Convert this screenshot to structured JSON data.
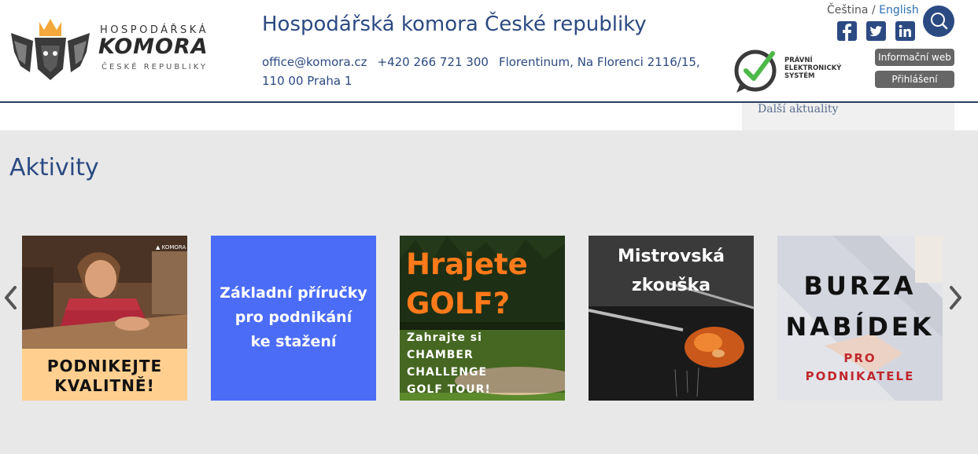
{
  "header": {
    "logo": {
      "line1": "HOSPODÁŘSKÁ",
      "line2": "KOMORA",
      "line3": "ČESKÉ REPUBLIKY"
    },
    "title": "Hospodářská komora České republiky",
    "contact": {
      "email": "office@komora.cz",
      "phone": "+420 266 721 300",
      "address": "Florentinum, Na Florenci 2116/15, 110 00 Praha 1"
    },
    "legal_system": {
      "line1": "PRÁVNÍ",
      "line2": "ELEKTRONICKÝ",
      "line3": "SYSTÉM"
    },
    "languages": {
      "cs": "Čeština",
      "separator": "/",
      "en": "English"
    },
    "social": [
      "facebook-icon",
      "twitter-icon",
      "linkedin-icon"
    ],
    "buttons": {
      "info_web": "Informační web",
      "login": "Přihlášení"
    }
  },
  "news": {
    "more_link": "Další aktuality"
  },
  "activities": {
    "title": "Aktivity",
    "cards": [
      {
        "lines": [
          "PODNIKEJTE",
          "KVALITNĚ!"
        ]
      },
      {
        "lines": [
          "Základní příručky",
          "pro podnikání",
          "ke stažení"
        ]
      },
      {
        "big": [
          "Hrajete",
          "GOLF?"
        ],
        "small": [
          "Zahrajte si",
          "CHAMBER",
          "CHALLENGE",
          "GOLF TOUR!"
        ]
      },
      {
        "lines": [
          "Mistrovská",
          "zkouška"
        ]
      },
      {
        "big": [
          "BURZA",
          "NABÍDEK"
        ],
        "small": [
          "PRO",
          "PODNIKATELE"
        ]
      }
    ]
  },
  "colors": {
    "brand_blue": "#2c4a82",
    "link_blue": "#2c6fb5",
    "card2_blue": "#4a6cf7",
    "golf_orange": "#ff7a1a",
    "burza_red": "#c0282d"
  }
}
